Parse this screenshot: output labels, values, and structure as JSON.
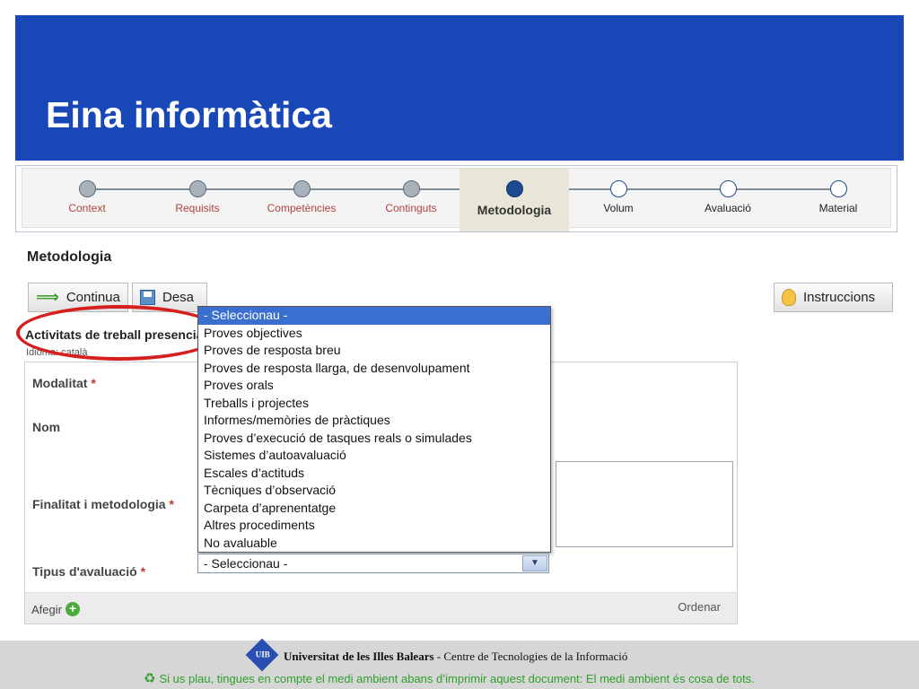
{
  "header": {
    "title": "Eina informàtica"
  },
  "steps": [
    {
      "label": "Context",
      "state": "done"
    },
    {
      "label": "Requisits",
      "state": "done"
    },
    {
      "label": "Competències",
      "state": "done"
    },
    {
      "label": "Continguts",
      "state": "done"
    },
    {
      "label": "Metodologia",
      "state": "active"
    },
    {
      "label": "Volum",
      "state": "future"
    },
    {
      "label": "Avaluació",
      "state": "future"
    },
    {
      "label": "Material",
      "state": "future"
    }
  ],
  "section": {
    "title": "Metodologia"
  },
  "toolbar": {
    "continua_label": "Continua",
    "desa_label": "Desa",
    "instruccions_label": "Instruccions"
  },
  "activity": {
    "label": "Activitats de treball presencial",
    "idioma": "Idioma: català"
  },
  "form": {
    "modalitat": "Modalitat",
    "nom": "Nom",
    "finalitat": "Finalitat i metodologia",
    "tipus": "Tipus d'avaluació",
    "required_mark": "*",
    "afegir": "Afegir",
    "ordenar": "Ordenar"
  },
  "dropdown": {
    "selected_value": "- Seleccionau -",
    "options": [
      "- Seleccionau -",
      "Proves objectives",
      "Proves de resposta breu",
      "Proves de resposta llarga, de desenvolupament",
      "Proves orals",
      "Treballs i projectes",
      "Informes/memòries de pràctiques",
      "Proves d’execució de tasques reals o simulades",
      "Sistemes d’autoavaluació",
      "Escales d’actituds",
      "Tècniques d’observació",
      "Carpeta d’aprenentatge",
      "Altres procediments",
      "No avaluable"
    ]
  },
  "footer": {
    "logo_text": "UIB",
    "university": "Universitat de les Illes Balears",
    "centre": " - Centre de Tecnologies de la Informació",
    "eco_notice": "Si us plau, tingues en compte el medi ambient abans d’imprimir aquest document: El medi ambient és cosa de tots."
  },
  "colors": {
    "title_bar": "#1848b8",
    "dropdown_highlight": "#3a6fd0",
    "annotation_ellipse": "#d62020",
    "eco_text": "#2fa02a"
  }
}
